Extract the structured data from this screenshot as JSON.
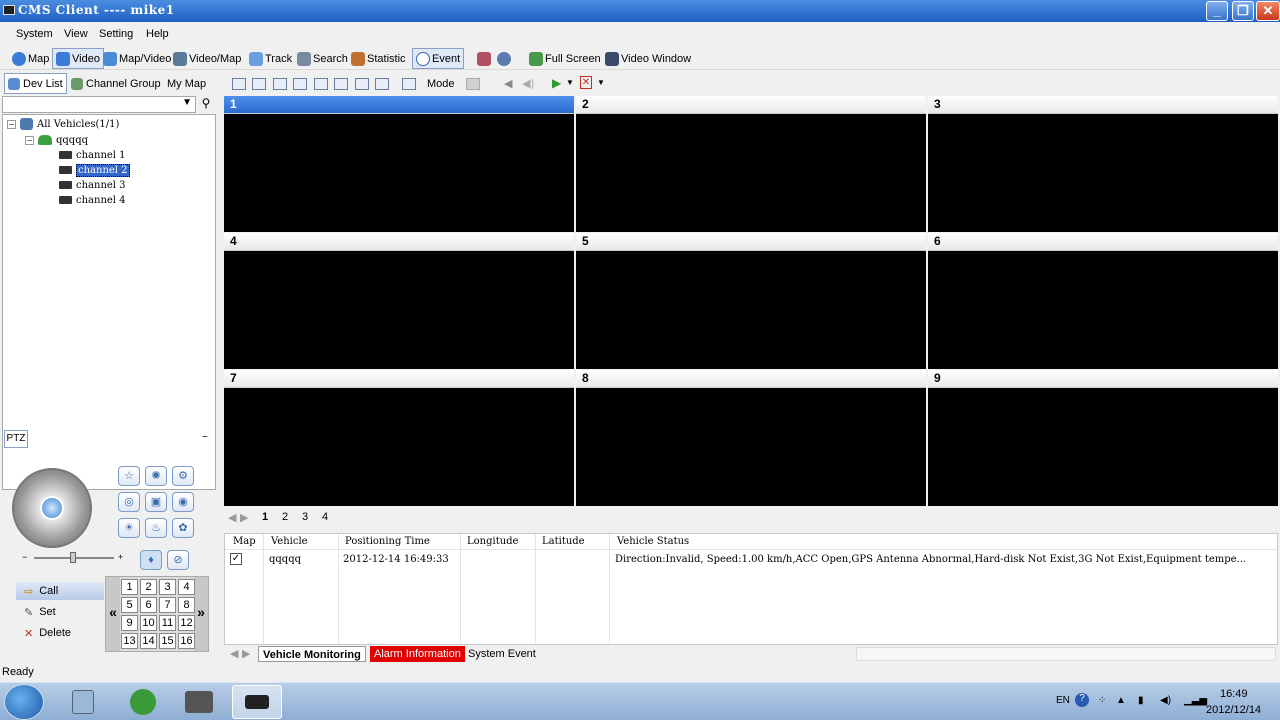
{
  "window": {
    "title": "CMS Client ---- mike1"
  },
  "menu": [
    "System",
    "View",
    "Setting",
    "Help"
  ],
  "toolbar": {
    "map": "Map",
    "video": "Video",
    "map_video": "Map/Video",
    "video_map": "Video/Map",
    "track": "Track",
    "search": "Search",
    "statistic": "Statistic",
    "event": "Event",
    "full_screen": "Full Screen",
    "video_window": "Video Window"
  },
  "left_tabs": {
    "dev_list": "Dev List",
    "channel_group": "Channel Group",
    "my_map": "My Map"
  },
  "tree": {
    "root": "All Vehicles(1/1)",
    "vehicle": "qqqqq",
    "channels": [
      "channel 1",
      "channel 2",
      "channel 3",
      "channel 4"
    ],
    "selected": "channel 2"
  },
  "ptz": {
    "title": "PTZ",
    "call": "Call",
    "set": "Set",
    "delete": "Delete",
    "numbers": [
      "1",
      "2",
      "3",
      "4",
      "5",
      "6",
      "7",
      "8",
      "9",
      "10",
      "11",
      "12",
      "13",
      "14",
      "15",
      "16"
    ],
    "prev": "«",
    "next": "»"
  },
  "video_toolbar": {
    "mode": "Mode"
  },
  "video_cells": [
    "1",
    "2",
    "3",
    "4",
    "5",
    "6",
    "7",
    "8",
    "9"
  ],
  "page_tabs": [
    "1",
    "2",
    "3",
    "4"
  ],
  "table": {
    "headers": [
      "Map",
      "Vehicle",
      "Positioning Time",
      "Longitude",
      "Latitude",
      "Vehicle Status"
    ],
    "rows": [
      {
        "checked": true,
        "vehicle": "qqqqq",
        "time": "2012-12-14 16:49:33",
        "longitude": "",
        "latitude": "",
        "status": "Direction:Invalid, Speed:1.00 km/h,ACC Open,GPS Antenna Abnormal,Hard-disk Not Exist,3G Not Exist,Equipment tempe..."
      }
    ]
  },
  "bottom_tabs": {
    "vehicle_monitoring": "Vehicle Monitoring",
    "alarm_information": "Alarm Information",
    "system_event": "System Event"
  },
  "status": "Ready",
  "tray": {
    "lang": "EN",
    "time": "16:49",
    "date": "2012/12/14"
  },
  "colors": {
    "title_blue": "#1f5fc4",
    "selected_cell": "#2b6cd0",
    "alarm_red": "#e00000"
  }
}
